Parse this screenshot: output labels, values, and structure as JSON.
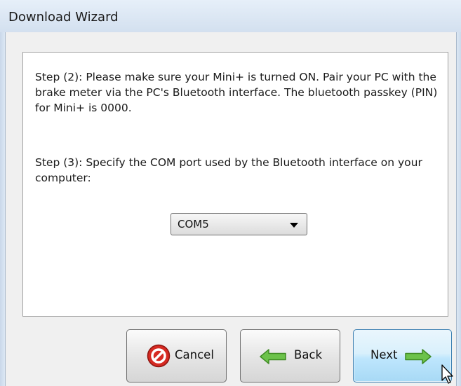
{
  "window": {
    "title": "Download Wizard"
  },
  "steps": {
    "step2": "Step (2): Please make sure your Mini+ is turned ON. Pair your PC with the brake meter via the PC's Bluetooth interface. The bluetooth passkey (PIN) for Mini+ is 0000.",
    "step3": "Step (3): Specify the COM port used by the Bluetooth interface on your computer:"
  },
  "com_port": {
    "selected": "COM5"
  },
  "buttons": {
    "cancel": "Cancel",
    "back": "Back",
    "next": "Next"
  },
  "icons": {
    "cancel": "no-entry-icon",
    "back": "left-arrow-icon",
    "next": "right-arrow-icon",
    "cursor": "mouse-pointer-icon"
  },
  "colors": {
    "arrow_green": "#6cc24a",
    "cancel_red": "#d62a22",
    "next_border": "#3c7fb1"
  }
}
